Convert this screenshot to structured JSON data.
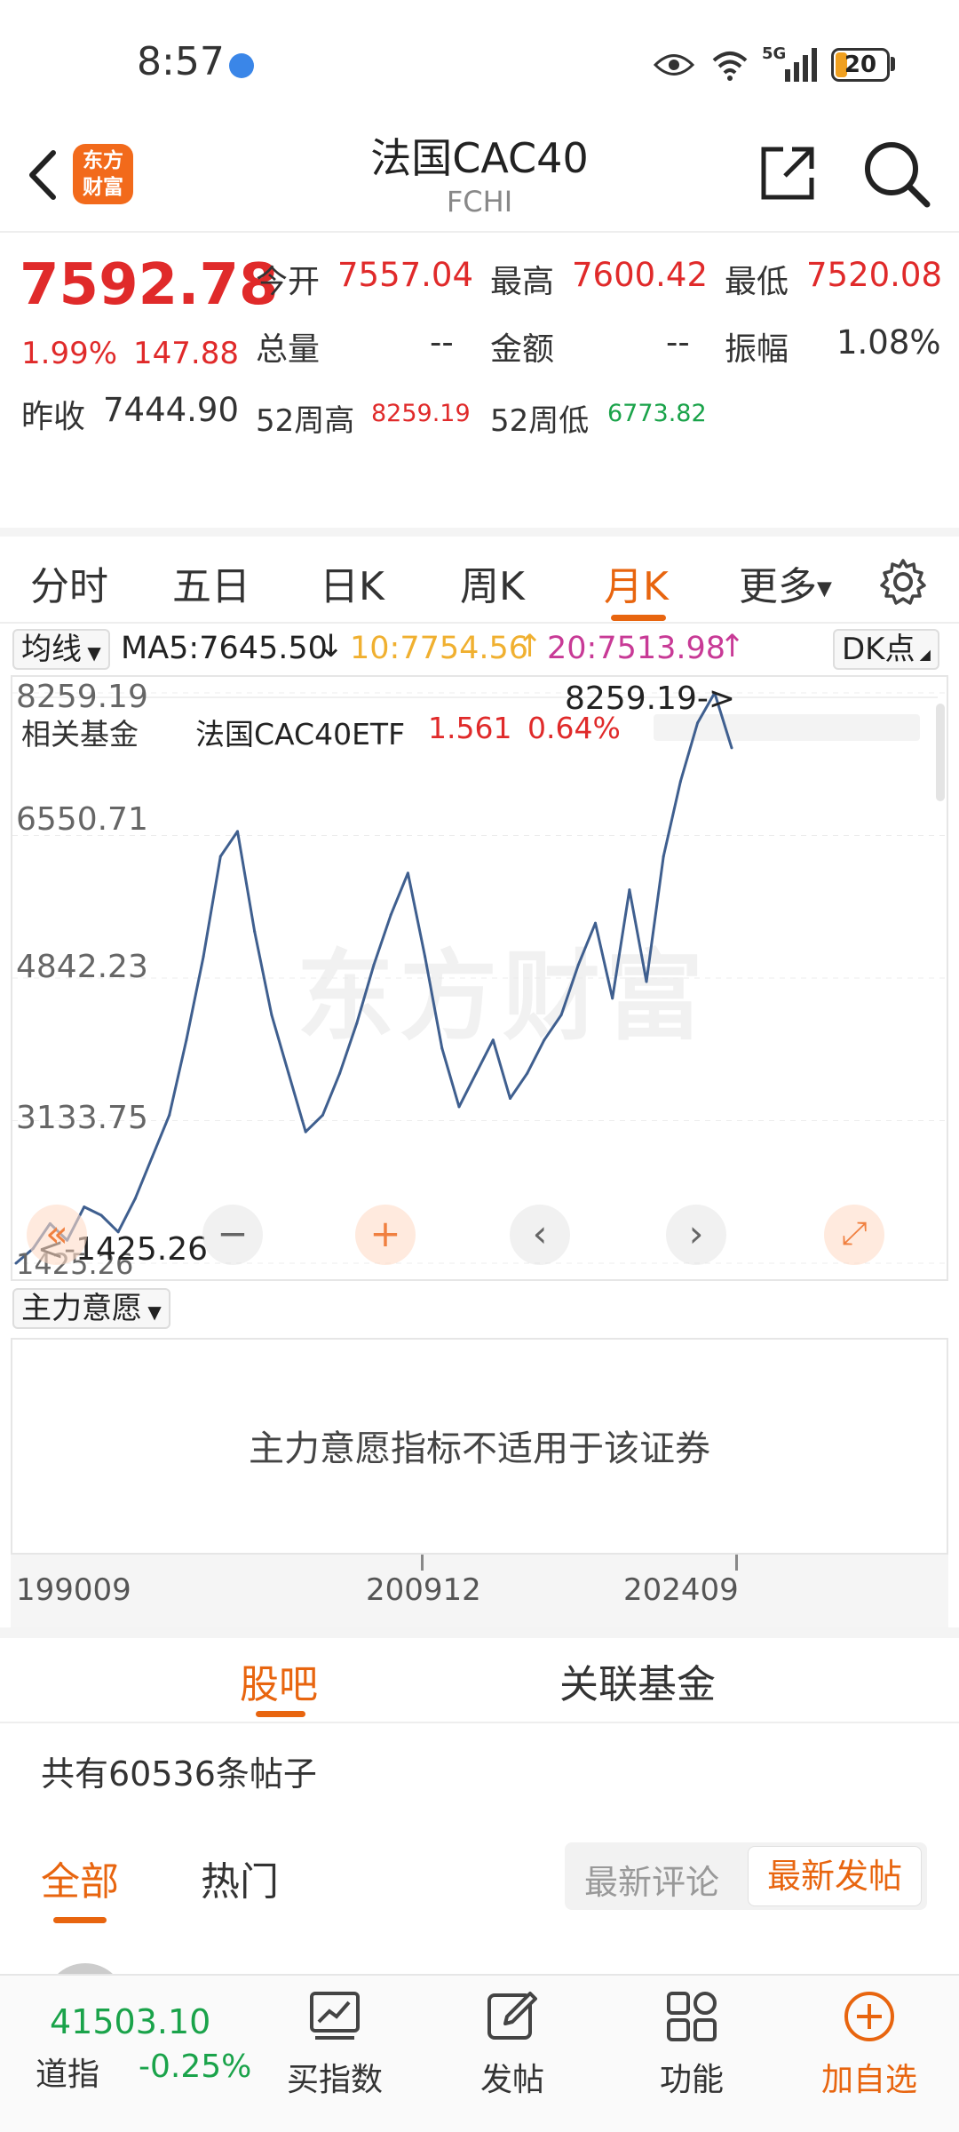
{
  "status_bar": {
    "time": "8:57",
    "battery": "20",
    "network": "5G"
  },
  "header": {
    "logo_line1": "东方",
    "logo_line2": "财富",
    "title": "法国CAC40",
    "subtitle": "FCHI"
  },
  "quote": {
    "price": "7592.78",
    "change_pct": "1.99%",
    "change": "147.88",
    "prev_close_label": "昨收",
    "prev_close": "7444.90",
    "open_label": "今开",
    "open": "7557.04",
    "high_label": "最高",
    "high": "7600.42",
    "low_label": "最低",
    "low": "7520.08",
    "volume_label": "总量",
    "volume": "--",
    "amount_label": "金额",
    "amount": "--",
    "amplitude_label": "振幅",
    "amplitude": "1.08%",
    "wk52_high_label": "52周高",
    "wk52_high": "8259.19",
    "wk52_low_label": "52周低",
    "wk52_low": "6773.82",
    "related_label": "相关基金",
    "related_fund": "法国CAC40ETF",
    "related_price": "1.561",
    "related_pct": "0.64%"
  },
  "period_tabs": [
    "分时",
    "五日",
    "日K",
    "周K",
    "月K",
    "更多"
  ],
  "active_period": "月K",
  "ma": {
    "selector": "均线",
    "ma5": "MA5:7645.50",
    "ma10": "10:7754.56",
    "ma20": "20:7513.98",
    "dk": "DK点"
  },
  "colors": {
    "up": "#e02a2a",
    "down": "#1aa34a",
    "accent": "#e8650f",
    "line": "#3f5f8f",
    "ma10": "#f0b030",
    "ma20": "#c83a96"
  },
  "chart_data": {
    "type": "line",
    "y_ticks": [
      "8259.19",
      "6550.71",
      "4842.23",
      "3133.75",
      "1425.26"
    ],
    "ylim": [
      1425.26,
      8259.19
    ],
    "max_annotation": "8259.19->",
    "min_annotation": "<-1425.26",
    "x_ticks": [
      "199009",
      "200912",
      "202409"
    ],
    "series": [
      {
        "values": [
          1425,
          1600,
          1900,
          1700,
          2100,
          2000,
          1800,
          2200,
          2700,
          3200,
          4100,
          5100,
          6300,
          6600,
          5400,
          4400,
          3700,
          3000,
          3200,
          3700,
          4300,
          5000,
          5600,
          6100,
          5100,
          4000,
          3300,
          3700,
          4100,
          3400,
          3700,
          4100,
          4400,
          5000,
          5500,
          4600,
          5900,
          4800,
          6300,
          7200,
          7900,
          8259,
          7600
        ]
      }
    ]
  },
  "chart_controls": [
    "minus",
    "plus",
    "prev",
    "next",
    "expand"
  ],
  "indicator": {
    "selector": "主力意愿",
    "message": "主力意愿指标不适用于该证券"
  },
  "bottom_tabs": [
    "股吧",
    "关联基金"
  ],
  "post_count": "共有60536条帖子",
  "filter_tabs": [
    "全部",
    "热门"
  ],
  "sort_options": [
    "最新评论",
    "最新发帖"
  ],
  "bottom_bar": {
    "index_value": "41503.10",
    "index_name": "道指",
    "index_pct": "-0.25%",
    "nav": [
      "买指数",
      "发帖",
      "功能",
      "加自选"
    ]
  }
}
